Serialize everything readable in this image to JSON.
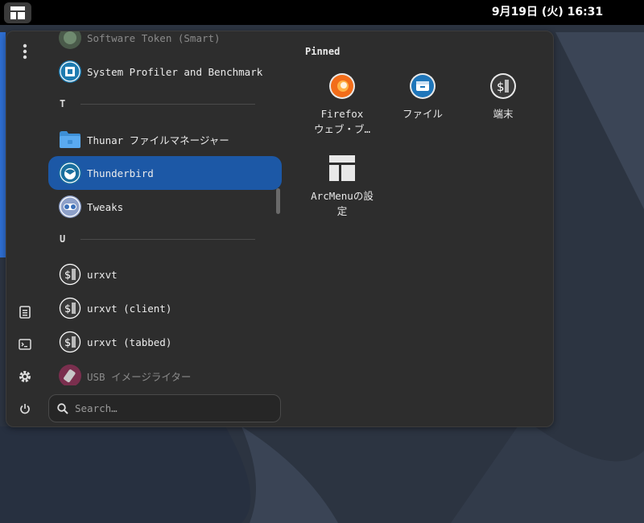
{
  "topbar": {
    "clock": "9月19日 (火) 16:31"
  },
  "menu": {
    "app_list": [
      {
        "label": "Software Token (Smart)",
        "icon": "software-token-icon",
        "faded": true
      },
      {
        "label": "System Profiler and Benchmark",
        "icon": "system-profiler-icon"
      },
      {
        "section": "T"
      },
      {
        "label": "Thunar ファイルマネージャー",
        "icon": "folder-icon"
      },
      {
        "label": "Thunderbird",
        "icon": "thunderbird-icon",
        "selected": true
      },
      {
        "label": "Tweaks",
        "icon": "tweaks-icon"
      },
      {
        "section": "U"
      },
      {
        "label": "urxvt",
        "icon": "terminal-icon"
      },
      {
        "label": "urxvt (client)",
        "icon": "terminal-icon"
      },
      {
        "label": "urxvt (tabbed)",
        "icon": "terminal-icon"
      },
      {
        "label": "USB イメージライター",
        "icon": "usb-icon",
        "faded": true
      }
    ],
    "search_placeholder": "Search…",
    "pinned_title": "Pinned",
    "pinned": [
      {
        "label": "Firefox\nウェブ・ブ…",
        "line1": "Firefox",
        "line2": "ウェブ・ブ…",
        "icon": "firefox-icon"
      },
      {
        "label": "ファイル",
        "icon": "files-icon"
      },
      {
        "label": "端末",
        "icon": "terminal-icon"
      },
      {
        "label": "ArcMenuの設定",
        "line1": "ArcMenuの設",
        "line2": "定",
        "icon": "arcmenu-settings-icon"
      }
    ]
  },
  "colors": {
    "panel_bg": "#2d2d2d",
    "selected_bg": "#1c58a6",
    "topbar_bg": "#000000"
  }
}
